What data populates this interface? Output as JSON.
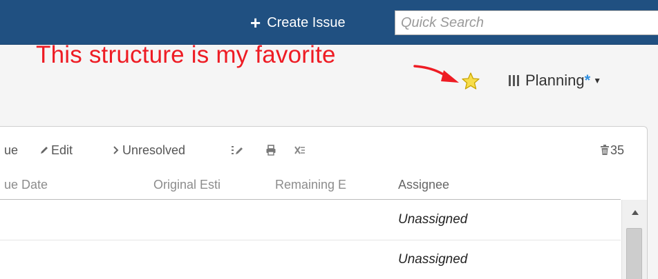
{
  "header": {
    "create_label": "Create Issue",
    "search_placeholder": "Quick Search"
  },
  "annotation": {
    "text": "This structure is my favorite",
    "color": "#ee1c24"
  },
  "favorite": {
    "icon": "star-icon",
    "color": "#f5d33a"
  },
  "structure_selector": {
    "icon": "columns-icon",
    "label": "Planning",
    "modified_marker": "*",
    "dropdown_icon": "caret-down-icon"
  },
  "toolbar": {
    "partial_item_label": "ue",
    "edit_label": "Edit",
    "filter_label": "Unresolved",
    "count_label": "35",
    "icons": [
      "pencil-icon",
      "chevron-right-icon",
      "edit-columns-icon",
      "print-icon",
      "export-excel-icon",
      "trash-icon"
    ]
  },
  "columns": [
    "ue Date",
    "Original Esti",
    "Remaining E",
    "Assignee"
  ],
  "rows": [
    {
      "assignee": "Unassigned"
    },
    {
      "assignee": "Unassigned"
    }
  ],
  "colors": {
    "header_bg": "#205081",
    "accent_blue": "#2f8fe0"
  }
}
